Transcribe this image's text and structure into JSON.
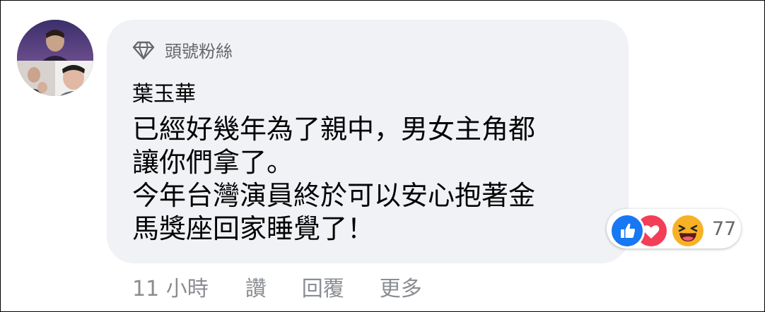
{
  "comment": {
    "badge_label": "頭號粉絲",
    "author": "葉玉華",
    "text_lines": [
      "已經好幾年為了親中，男女主角都",
      "讓你們拿了。",
      "今年台灣演員終於可以安心抱著金",
      "馬獎座回家睡覺了！"
    ]
  },
  "reactions": {
    "count": "77",
    "types": [
      "like-icon",
      "love-icon",
      "haha-icon"
    ],
    "colors": {
      "like": "#1877f2",
      "love": "#f33e58",
      "haha": "#f7b125"
    }
  },
  "actions": {
    "timestamp": "11 小時",
    "like_label": "讚",
    "reply_label": "回覆",
    "more_label": "更多"
  }
}
